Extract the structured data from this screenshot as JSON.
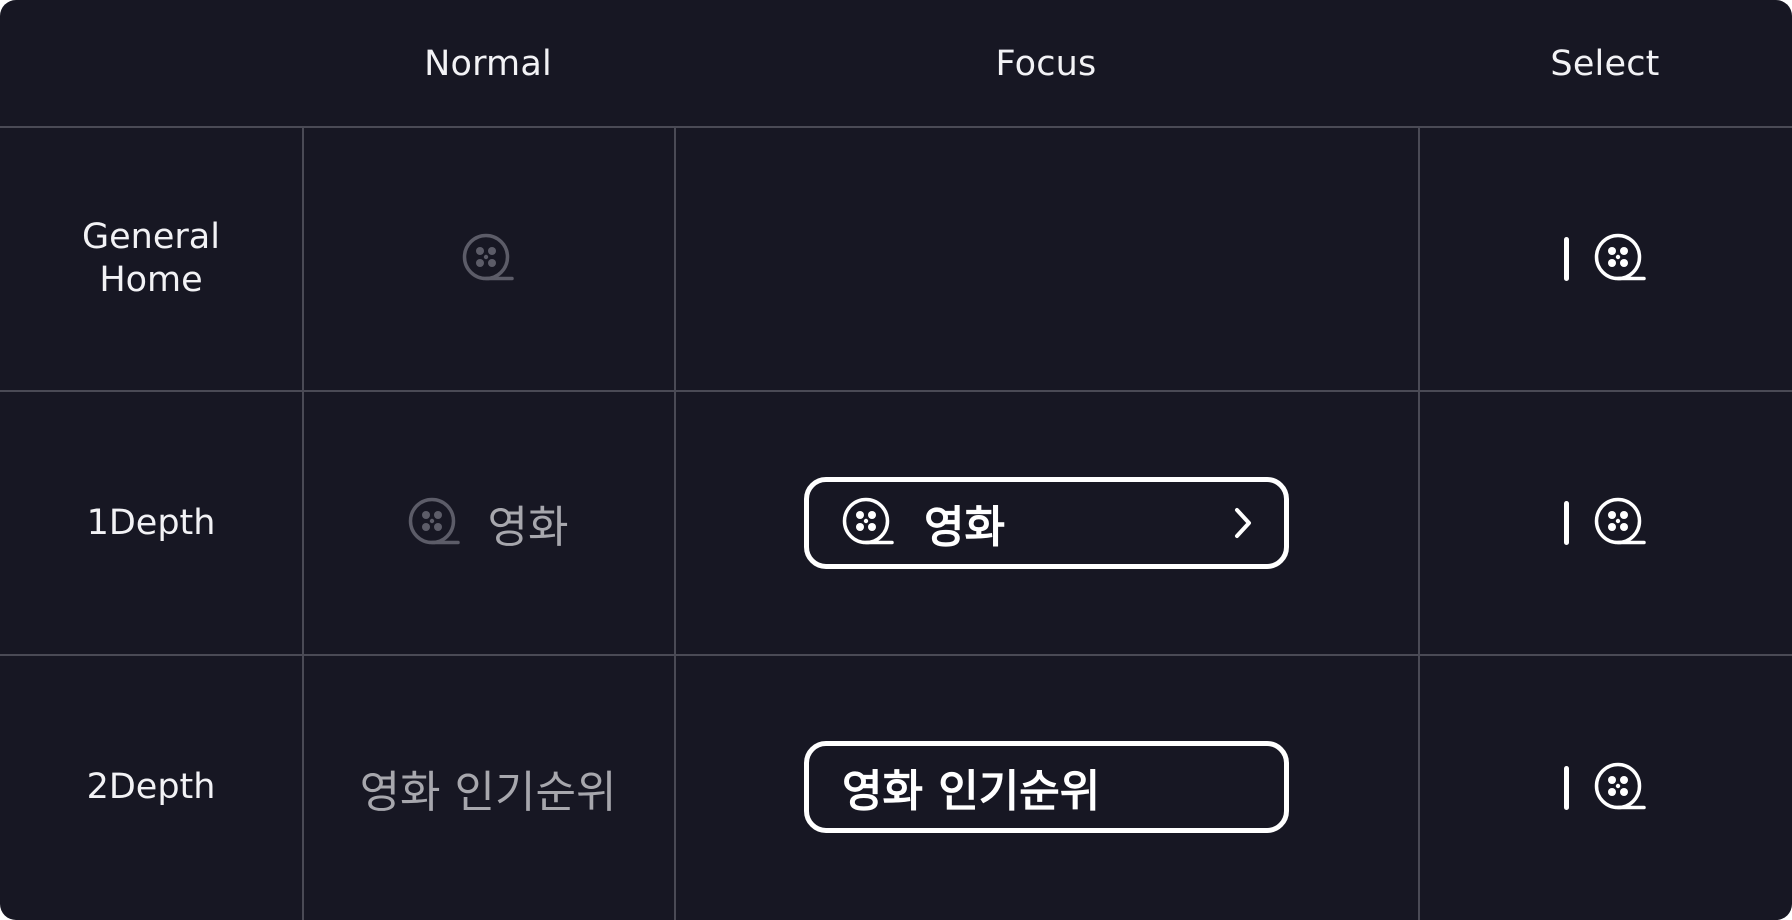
{
  "columns": {
    "normal": "Normal",
    "focus": "Focus",
    "select": "Select"
  },
  "rows": {
    "general_home": {
      "label_line1": "General",
      "label_line2": "Home"
    },
    "depth1": {
      "label": "1Depth",
      "normal_text": "영화",
      "focus_text": "영화"
    },
    "depth2": {
      "label": "2Depth",
      "normal_text": "영화 인기순위",
      "focus_text": "영화 인기순위"
    }
  },
  "icons": {
    "menu_icon": "film-reel-icon",
    "focus_arrow": "chevron-right-icon",
    "select_indicator": "selection-bar"
  },
  "colors": {
    "background": "#171723",
    "grid_line": "#4a4a55",
    "text_primary": "#f2f2f5",
    "text_dim": "#a7a7ad",
    "icon_dim": "#5c5c68",
    "focus_border": "#ffffff"
  }
}
